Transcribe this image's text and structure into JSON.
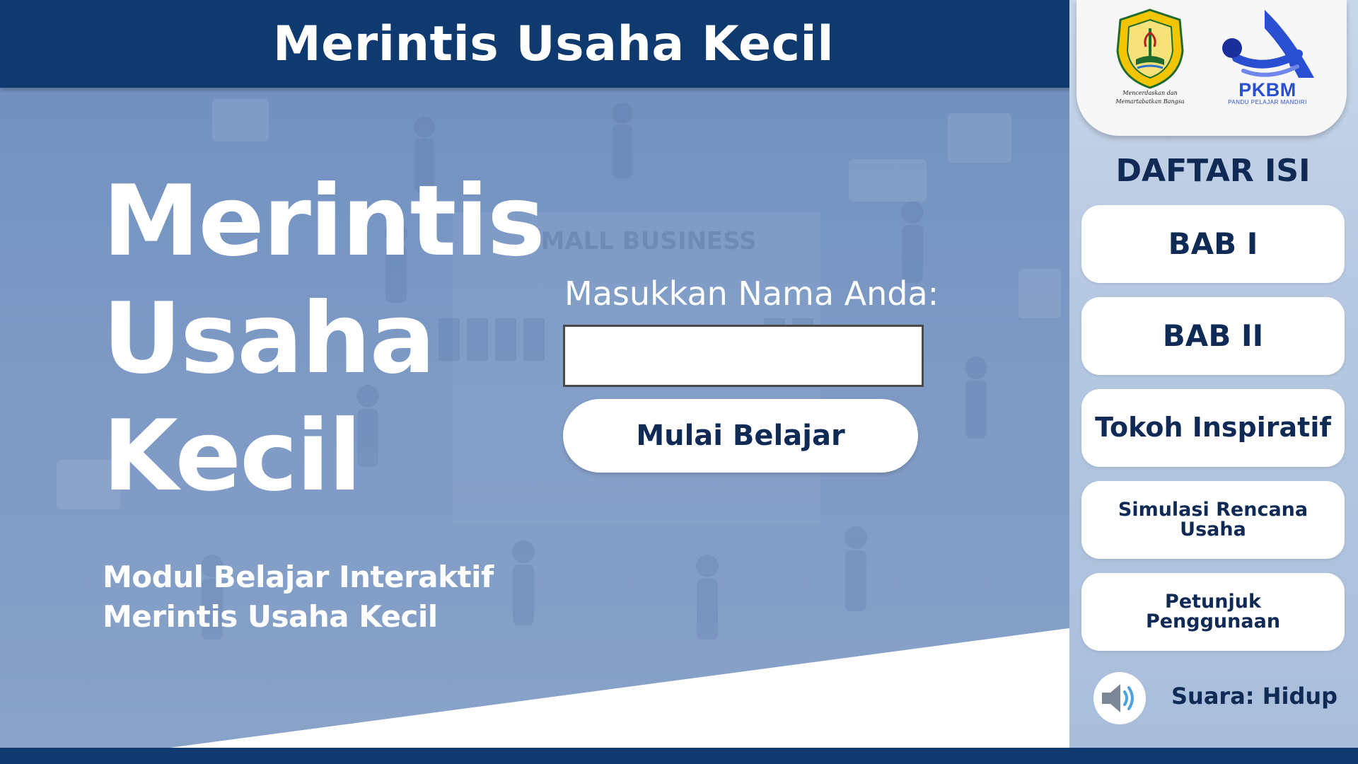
{
  "header": {
    "title": "Merintis Usaha Kecil"
  },
  "hero": {
    "title_lines": [
      "Merintis",
      "Usaha",
      "Kecil"
    ],
    "subtitle_lines": [
      "Modul Belajar Interaktif",
      "Merintis Usaha Kecil"
    ],
    "background_sign": "SMALL BUSINESS"
  },
  "name_form": {
    "label": "Masukkan Nama Anda:",
    "input_value": "",
    "input_placeholder": "",
    "start_button": "Mulai Belajar"
  },
  "logos": {
    "university_motto": "Mencerdaskan dan Memartabatkan Bangsa",
    "pkbm_name": "PKBM",
    "pkbm_tagline": "PANDU PELAJAR MANDIRI"
  },
  "sidebar": {
    "heading": "DAFTAR ISI",
    "items": [
      {
        "label": "BAB I"
      },
      {
        "label": "BAB II"
      },
      {
        "label": "Tokoh Inspiratif"
      },
      {
        "label": "Simulasi Rencana Usaha"
      },
      {
        "label": "Petunjuk Penggunaan"
      }
    ],
    "sound": {
      "label": "Suara: Hidup",
      "icon": "speaker-icon"
    }
  },
  "colors": {
    "navy": "#0e3a70",
    "text_navy": "#0e2a55",
    "hero_blue": "#7c99c4",
    "sidebar_blue": "#b6c8e1",
    "pkbm_blue": "#2a4fd0"
  }
}
